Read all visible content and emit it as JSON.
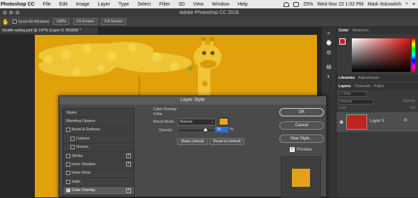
{
  "menubar": {
    "app": "Photoshop CC",
    "items": [
      "File",
      "Edit",
      "Image",
      "Layer",
      "Type",
      "Select",
      "Filter",
      "3D",
      "View",
      "Window",
      "Help"
    ],
    "battery": "25%",
    "datetime": "Wed Nov 22 1:02 PM",
    "user": "Mark Itskowitch"
  },
  "titlebar": {
    "title": "Adobe Photoshop CC 2018"
  },
  "options": {
    "scroll_all": "Scroll All Windows",
    "zoom": "100%",
    "fit_screen": "Fit Screen",
    "fill_screen": "Fill Screen"
  },
  "document": {
    "tab": "Giraffe-eating.psd @ 197% (Layer 0, RGB/8) *",
    "fill_color": "#e0a10a"
  },
  "panels": {
    "color_tabs": [
      "Color",
      "Swatches"
    ],
    "mid_tabs": [
      "Libraries",
      "Adjustments"
    ],
    "layer_tabs": [
      "Layers",
      "Channels",
      "Paths"
    ],
    "kind": "Kind",
    "blend": "Normal",
    "opacity_label": "Opacity:",
    "lock_label": "Lock:",
    "fill_label": "Fill:",
    "layer_name": "Layer 0",
    "fx": "fx"
  },
  "dialog": {
    "title": "Layer Style",
    "styles": [
      {
        "label": "Styles",
        "check": false,
        "plus": false,
        "indent": false
      },
      {
        "label": "Blending Options",
        "check": false,
        "plus": false,
        "indent": false
      },
      {
        "label": "Bevel & Emboss",
        "check": true,
        "checked": false,
        "plus": false,
        "indent": false
      },
      {
        "label": "Contour",
        "check": true,
        "checked": false,
        "plus": false,
        "indent": true
      },
      {
        "label": "Texture",
        "check": true,
        "checked": false,
        "plus": false,
        "indent": true
      },
      {
        "label": "Stroke",
        "check": true,
        "checked": false,
        "plus": true,
        "indent": false
      },
      {
        "label": "Inner Shadow",
        "check": true,
        "checked": false,
        "plus": true,
        "indent": false
      },
      {
        "label": "Inner Glow",
        "check": true,
        "checked": false,
        "plus": false,
        "indent": false
      },
      {
        "label": "Satin",
        "check": true,
        "checked": false,
        "plus": false,
        "indent": false
      },
      {
        "label": "Color Overlay",
        "check": true,
        "checked": true,
        "plus": true,
        "indent": false,
        "selected": true
      }
    ],
    "section_title": "Color Overlay",
    "section_sub": "Color",
    "blend_label": "Blend Mode:",
    "blend_value": "Normal",
    "overlay_color": "#e8a516",
    "opacity_label": "Opacity:",
    "opacity_value": "76",
    "opacity_unit": "%",
    "make_default": "Make Default",
    "reset_default": "Reset to Default",
    "ok": "OK",
    "cancel": "Cancel",
    "new_style": "New Style...",
    "preview": "Preview",
    "preview_color": "#e3a21e"
  }
}
